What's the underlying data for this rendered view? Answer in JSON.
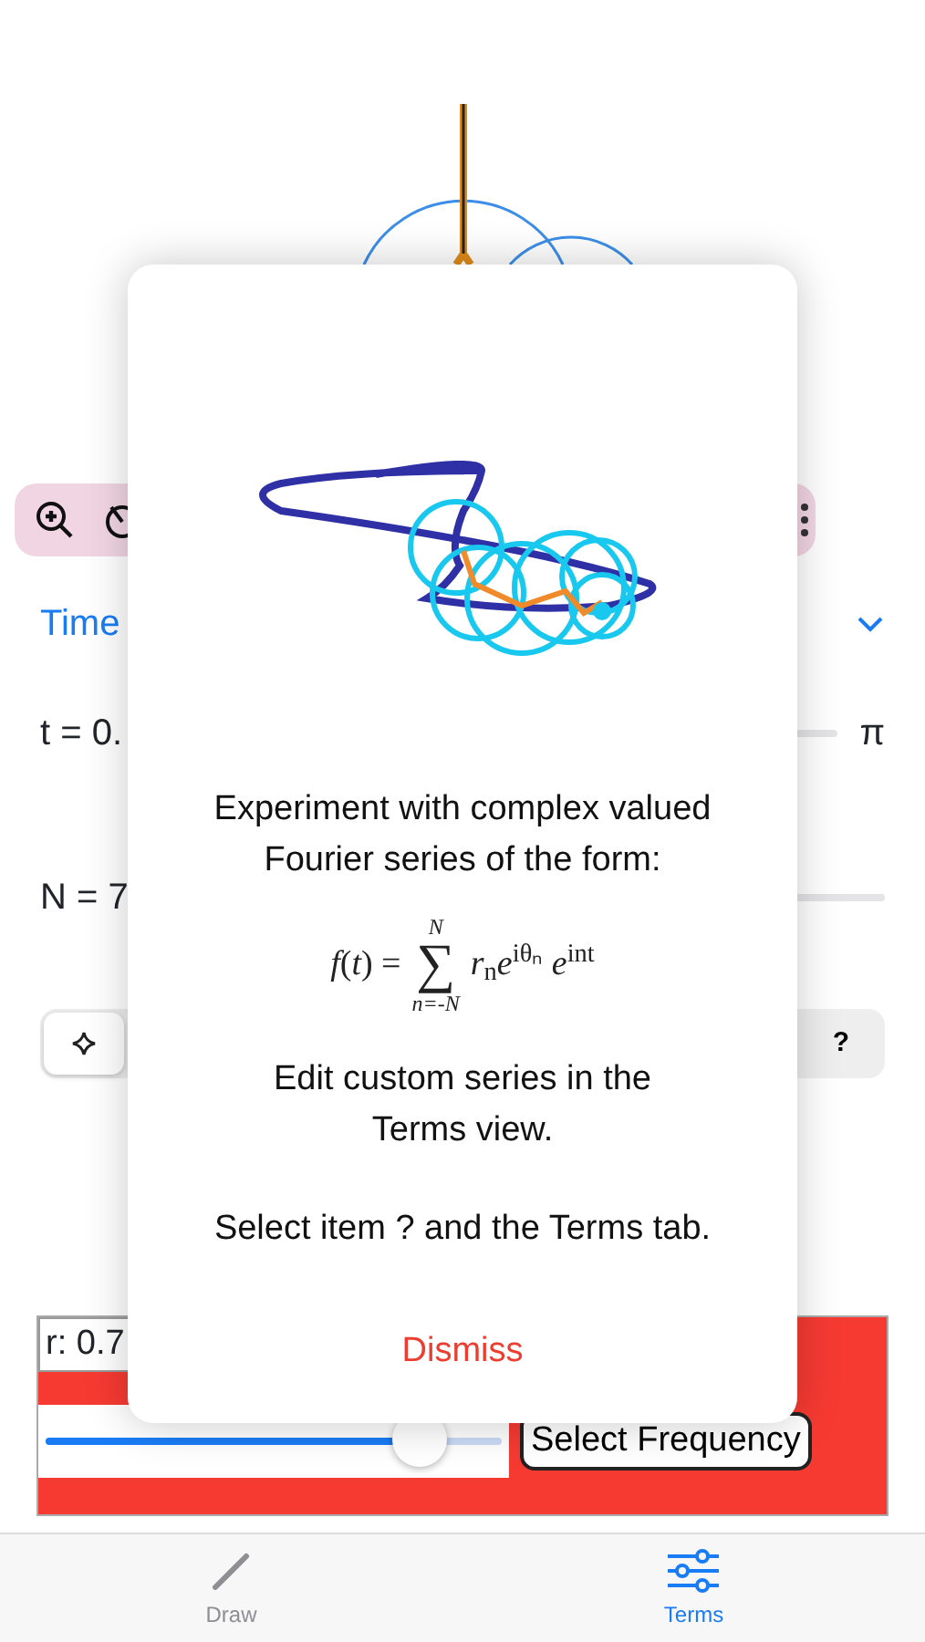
{
  "time_section": {
    "label": "Time",
    "expanded": true
  },
  "t_row": {
    "label": "t = 0.",
    "max_label": "π"
  },
  "n_row": {
    "label": "N = 7"
  },
  "segments": [
    {
      "kind": "icon",
      "selected": true
    },
    {
      "kind": "text",
      "label": "?",
      "selected": false
    }
  ],
  "term_panel": {
    "radius_value": "r: 0.7",
    "radius_slider": {
      "level": 0.82
    },
    "select_button": "Select Frequency"
  },
  "dialog": {
    "intro": "Experiment with complex valued Fourier series of the form:",
    "formula": {
      "lhs": "*f*(*t*) =",
      "sign": "∑",
      "upper": "N",
      "lower": "n=-N",
      "body": "*r*$_{n}$*e*$^{iθₙ}$ *e*$^{int}$"
    },
    "paragraphs": [
      "Edit custom series in the Terms view.",
      "Select item ? and the Terms tab."
    ],
    "dismiss": "Dismiss"
  },
  "tabs": [
    {
      "label": "Draw",
      "selected": false
    },
    {
      "label": "Terms",
      "selected": true
    }
  ]
}
